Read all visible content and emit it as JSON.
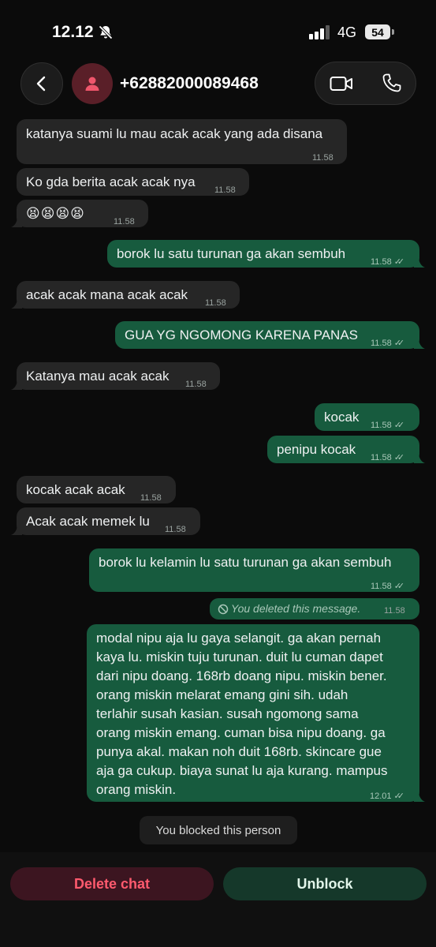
{
  "status": {
    "time": "12.12",
    "network": "4G",
    "battery": "54"
  },
  "header": {
    "contact": "+62882000089468"
  },
  "messages": [
    {
      "text": "katanya suami lu mau acak acak yang ada disana",
      "time": "11.58"
    },
    {
      "text": "Ko gda berita acak acak nya",
      "time": "11.58"
    },
    {
      "text": "😫😫😫😫",
      "time": "11.58"
    },
    {
      "text": "borok lu satu turunan ga akan sembuh",
      "time": "11.58"
    },
    {
      "text": "acak acak mana acak acak",
      "time": "11.58"
    },
    {
      "text": "GUA YG NGOMONG KARENA PANAS",
      "time": "11.58"
    },
    {
      "text": "Katanya mau acak acak",
      "time": "11.58"
    },
    {
      "text": "kocak",
      "time": "11.58"
    },
    {
      "text": "penipu kocak",
      "time": "11.58"
    },
    {
      "text": "kocak acak acak",
      "time": "11.58"
    },
    {
      "text": "Acak acak memek lu",
      "time": "11.58"
    },
    {
      "text": "borok lu kelamin lu satu turunan ga akan sembuh",
      "time": "11.58"
    },
    {
      "text": "You deleted this message.",
      "time": "11.58"
    },
    {
      "lines": [
        "modal nipu aja lu gaya selangit. ga akan pernah",
        "kaya lu. miskin tuju turunan. duit lu cuman dapet",
        "dari nipu doang. 168rb doang nipu. miskin bener.",
        "orang miskin melarat emang gini sih. udah",
        "terlahir susah kasian. susah ngomong sama",
        "orang miskin emang. cuman bisa nipu doang. ga",
        "punya akal. makan noh duit 168rb. skincare gue",
        "aja ga cukup. biaya sunat lu aja kurang. mampus",
        "orang miskin."
      ],
      "time": "12.01"
    }
  ],
  "notice": "You blocked this person",
  "actions": {
    "delete": "Delete chat",
    "unblock": "Unblock"
  },
  "colors": {
    "incoming": "#262626",
    "outgoing": "#175b3e",
    "delete": "#ff5a6e"
  }
}
